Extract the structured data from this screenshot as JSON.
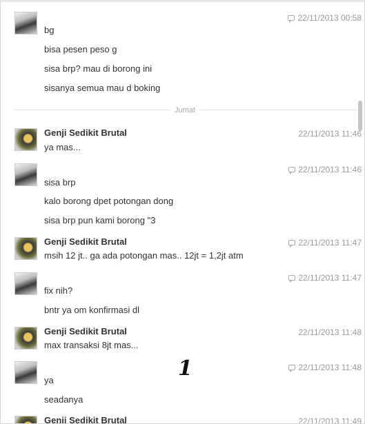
{
  "divider": {
    "label": "Jumat"
  },
  "overlay": {
    "number": "1"
  },
  "messages": [
    {
      "avatar": "girl-avatar",
      "sender": "",
      "time": "22/11/2013 00:58",
      "icon": "reply-bubble-icon",
      "lines": [
        "bg",
        "bisa pesen peso g",
        "sisa brp? mau di borong ini",
        "sisanya semua mau d boking"
      ]
    },
    {
      "avatar": "genji-avatar",
      "sender": "Genji Sedikit Brutal",
      "time": "22/11/2013 11:46",
      "icon": "",
      "lines": [
        "ya mas..."
      ]
    },
    {
      "avatar": "girl-avatar",
      "sender": "",
      "time": "22/11/2013 11:46",
      "icon": "reply-bubble-icon",
      "lines": [
        "sisa brp",
        "kalo borong dpet potongan dong",
        "sisa brp pun kami borong \"3"
      ]
    },
    {
      "avatar": "genji-avatar",
      "sender": "Genji Sedikit Brutal",
      "time": "22/11/2013 11:47",
      "icon": "reply-bubble-icon",
      "lines": [
        "msih 12 jt..  ga ada potongan mas.. 12jt  = 1,2jt atm"
      ]
    },
    {
      "avatar": "girl-avatar",
      "sender": "",
      "time": "22/11/2013 11:47",
      "icon": "reply-bubble-icon",
      "lines": [
        "fix nih?",
        "bntr ya om konfirmasi dl"
      ]
    },
    {
      "avatar": "genji-avatar",
      "sender": "Genji Sedikit Brutal",
      "time": "22/11/2013 11:48",
      "icon": "",
      "lines": [
        "max transaksi 8jt mas..."
      ]
    },
    {
      "avatar": "girl-avatar",
      "sender": "",
      "time": "22/11/2013 11:48",
      "icon": "reply-bubble-icon",
      "lines": [
        "ya",
        "seadanya"
      ]
    },
    {
      "avatar": "genji-avatar",
      "sender": "Genji Sedikit Brutal",
      "time": "22/11/2013 11:49",
      "icon": "",
      "lines": []
    }
  ]
}
